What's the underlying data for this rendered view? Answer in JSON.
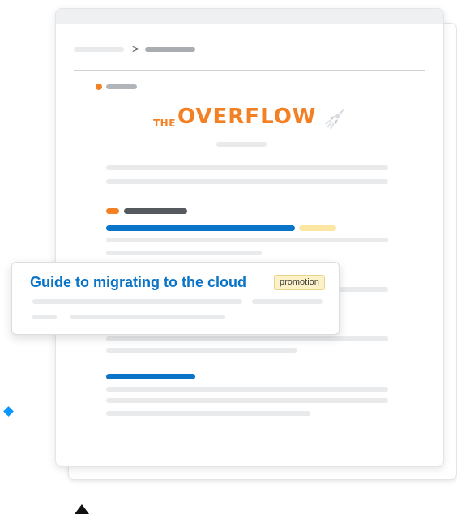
{
  "breadcrumb": {
    "separator": ">"
  },
  "newsletter": {
    "logo_prefix": "THE",
    "logo_word": "OVERFLOW",
    "logo_icon": "rocket-icon"
  },
  "promotion": {
    "title": "Guide to migrating to the cloud",
    "badge": "promotion"
  },
  "colors": {
    "accent_orange": "#f48024",
    "link_blue": "#0a74c9",
    "diamond_blue": "#0a95ff",
    "badge_bg": "#fdf2c7",
    "skeleton_gray": "#e8eaec",
    "skeleton_dark": "#55595e"
  },
  "decorations": [
    "diamond-shape",
    "triangle-shape"
  ]
}
